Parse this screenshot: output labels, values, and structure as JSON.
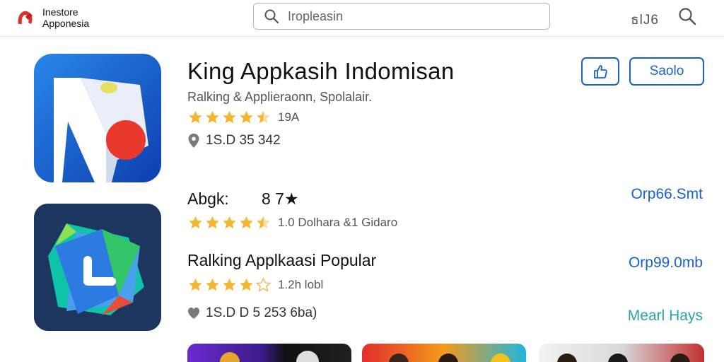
{
  "header": {
    "logo_line1": "Inestore",
    "logo_line2": "Apponesia",
    "search_placeholder": "Iropleasin",
    "right_label": "ธlJ6"
  },
  "featured": {
    "title": "King Appkasih Indomisan",
    "subtitle": "Ralking & Applieraonn, Spolalair.",
    "rating_value": 4.5,
    "rating_text": "19A",
    "meta": "1S.D 35 342",
    "save_label": "Saolo"
  },
  "rows": [
    {
      "title": "Abgk:",
      "extra": "8 7★",
      "rating_value": 4.5,
      "rating_text": "1.0 Dolhara &1 Gidaro",
      "price": "Orp66.Smt"
    },
    {
      "title": "Ralking Applkaasi Popular",
      "rating_value": 4.5,
      "rating_text": "1.2h lobl",
      "meta": "1S.D D 5 253 6ba)",
      "price": "Orp99.0mb",
      "link": "Mearl Hays"
    }
  ],
  "colors": {
    "accent": "#1a62c7",
    "star": "#f5b731",
    "link": "#2aa4a8"
  }
}
